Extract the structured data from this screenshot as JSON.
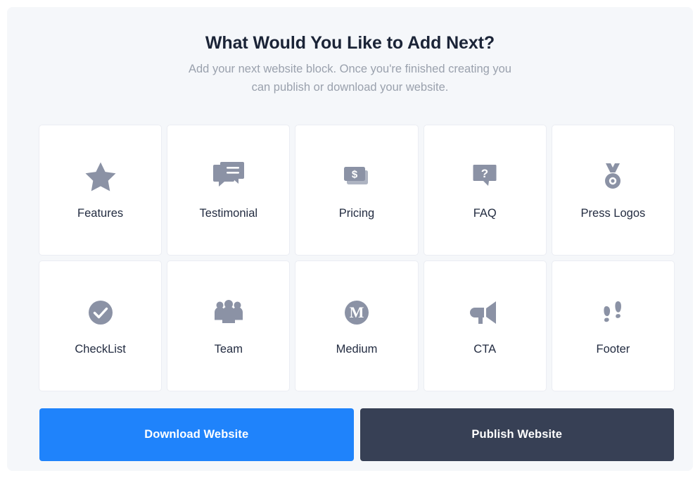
{
  "header": {
    "title": "What Would You Like to Add Next?",
    "subtitle": "Add your next website block. Once you're finished creating you can publish or download your website."
  },
  "colors": {
    "panel_background": "#f5f7fa",
    "card_background": "#ffffff",
    "icon": "#8b92a5",
    "label_text": "#232c41",
    "title_text": "#1b2437",
    "subtitle_text": "#9aa1ad",
    "download_button": "#1f83fb",
    "publish_button": "#374055"
  },
  "blocks": [
    {
      "label": "Features",
      "icon": "star-icon"
    },
    {
      "label": "Testimonial",
      "icon": "speech-bubbles-icon"
    },
    {
      "label": "Pricing",
      "icon": "dollar-cards-icon"
    },
    {
      "label": "FAQ",
      "icon": "question-bubble-icon"
    },
    {
      "label": "Press Logos",
      "icon": "medal-icon"
    },
    {
      "label": "CheckList",
      "icon": "check-circle-icon"
    },
    {
      "label": "Team",
      "icon": "people-group-icon"
    },
    {
      "label": "Medium",
      "icon": "medium-circle-icon"
    },
    {
      "label": "CTA",
      "icon": "megaphone-icon"
    },
    {
      "label": "Footer",
      "icon": "footprints-icon"
    }
  ],
  "actions": {
    "download_label": "Download Website",
    "publish_label": "Publish Website"
  }
}
